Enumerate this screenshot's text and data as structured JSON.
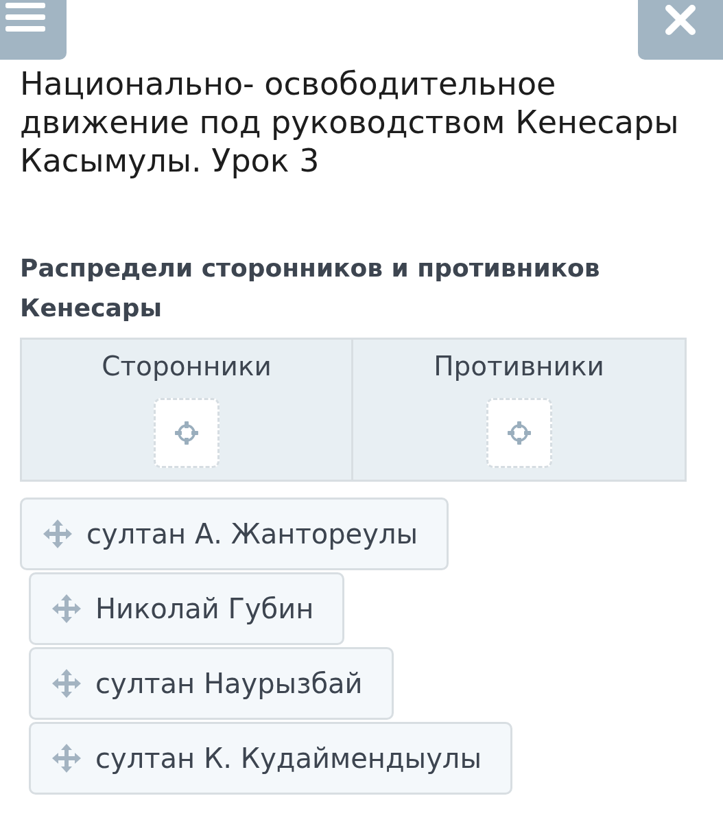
{
  "title": "Национально- освободительное движение под руководством Кенесары Касымулы. Урок 3",
  "task": "Распредели сторонников и противников Кенесары",
  "columns": [
    {
      "heading": "Сторонники"
    },
    {
      "heading": "Противники"
    }
  ],
  "items": [
    {
      "label": "султан А. Жантореулы"
    },
    {
      "label": "Николай Губин"
    },
    {
      "label": "султан Наурызбай"
    },
    {
      "label": "султан К. Кудаймендыулы"
    }
  ]
}
